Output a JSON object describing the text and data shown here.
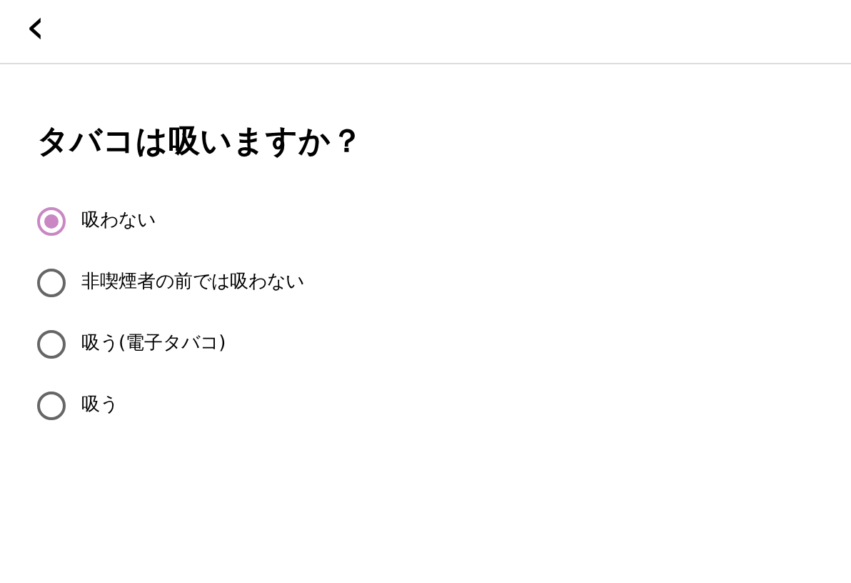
{
  "header": {
    "back": "‹"
  },
  "question": "タバコは吸いますか？",
  "options": [
    {
      "label": "吸わない",
      "selected": true
    },
    {
      "label": "非喫煙者の前では吸わない",
      "selected": false
    },
    {
      "label": "吸う(電子タバコ)",
      "selected": false
    },
    {
      "label": "吸う",
      "selected": false
    }
  ]
}
